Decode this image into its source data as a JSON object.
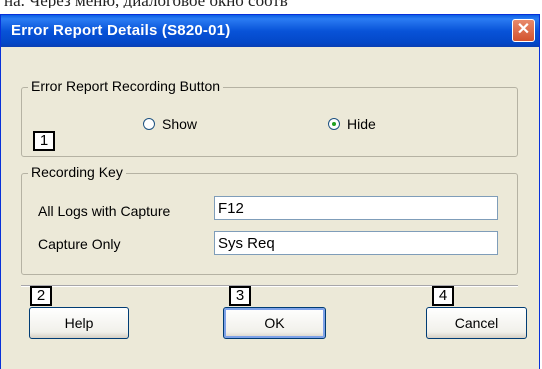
{
  "cutoff_text": "на. Через меню, диалоговое окно соотв",
  "window": {
    "title": "Error Report Details (S820-01)",
    "close_label": "✕"
  },
  "recording_button_group": {
    "title": "Error Report Recording Button",
    "options": [
      {
        "label": "Show",
        "checked": false
      },
      {
        "label": "Hide",
        "checked": true
      }
    ]
  },
  "recording_key_group": {
    "title": "Recording Key",
    "fields": [
      {
        "label": "All Logs with Capture",
        "value": "F12"
      },
      {
        "label": "Capture Only",
        "value": "Sys Req"
      }
    ]
  },
  "buttons": {
    "help": "Help",
    "ok": "OK",
    "cancel": "Cancel"
  },
  "callouts": [
    "1",
    "2",
    "3",
    "4"
  ]
}
